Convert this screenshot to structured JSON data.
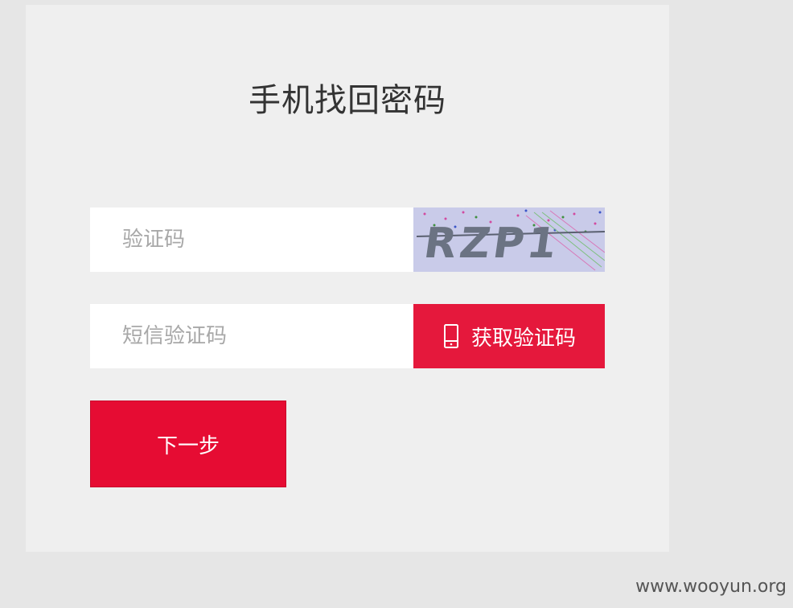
{
  "page": {
    "title": "手机找回密码"
  },
  "form": {
    "captcha_placeholder": "验证码",
    "captcha_text": "RZP1",
    "sms_placeholder": "短信验证码",
    "sms_button_label": "获取验证码",
    "next_button_label": "下一步"
  },
  "icons": {
    "sms_button_icon": "phone-icon"
  },
  "colors": {
    "accent": "#e60c33",
    "card_background": "#efefef",
    "page_background": "#e6e6e6",
    "captcha_background": "#c9cbe9"
  },
  "watermark": {
    "text": "www.wooyun.org"
  }
}
